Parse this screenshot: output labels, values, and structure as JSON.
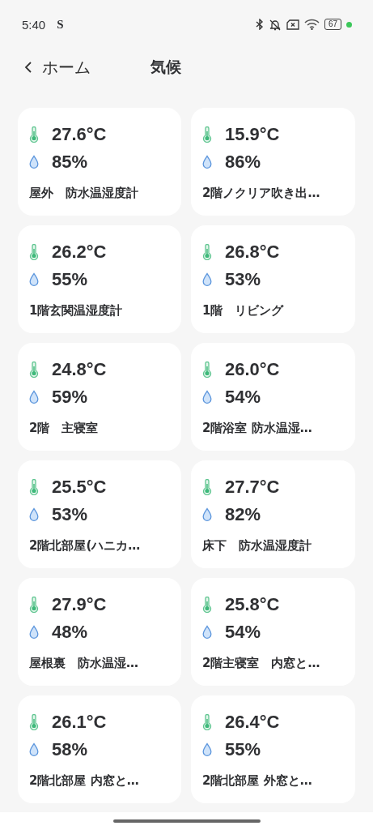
{
  "status_bar": {
    "time": "5:40",
    "notification_glyph": "S",
    "battery": "67"
  },
  "header": {
    "back_label": "ホーム",
    "title": "気候"
  },
  "sensors": [
    {
      "temperature": "27.6°C",
      "humidity": "85%",
      "name": "屋外　防水温湿度計"
    },
    {
      "temperature": "15.9°C",
      "humidity": "86%",
      "name": "2階ノクリア吹き出…"
    },
    {
      "temperature": "26.2°C",
      "humidity": "55%",
      "name": "1階玄関温湿度計"
    },
    {
      "temperature": "26.8°C",
      "humidity": "53%",
      "name": "1階　リビング"
    },
    {
      "temperature": "24.8°C",
      "humidity": "59%",
      "name": "2階　主寝室"
    },
    {
      "temperature": "26.0°C",
      "humidity": "54%",
      "name": "2階浴室 防水温湿…"
    },
    {
      "temperature": "25.5°C",
      "humidity": "53%",
      "name": "2階北部屋(ハニカ…"
    },
    {
      "temperature": "27.7°C",
      "humidity": "82%",
      "name": "床下　防水温湿度計"
    },
    {
      "temperature": "27.9°C",
      "humidity": "48%",
      "name": "屋根裏　防水温湿…"
    },
    {
      "temperature": "25.8°C",
      "humidity": "54%",
      "name": "2階主寝室　内窓と…"
    },
    {
      "temperature": "26.1°C",
      "humidity": "58%",
      "name": "2階北部屋 内窓と…"
    },
    {
      "temperature": "26.4°C",
      "humidity": "55%",
      "name": "2階北部屋 外窓と…"
    }
  ]
}
